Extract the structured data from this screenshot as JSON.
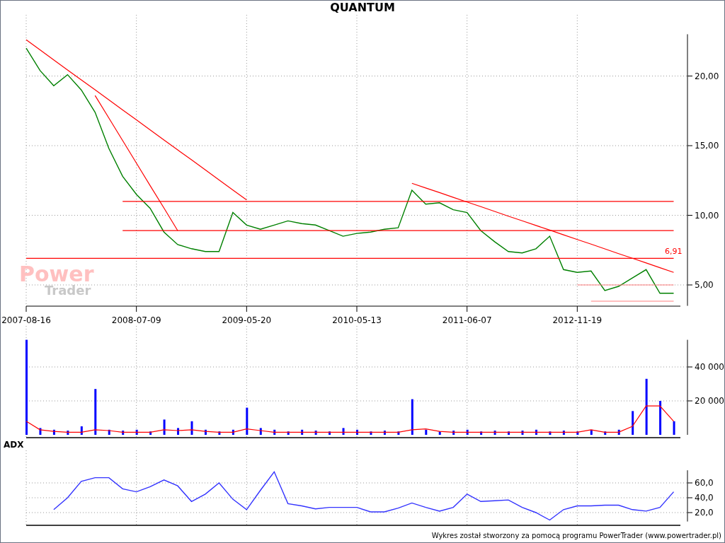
{
  "title": "QUANTUM",
  "logo": {
    "line1": "Power",
    "line2": "Trader"
  },
  "price_panel": {
    "chart_data": {
      "type": "line",
      "ylim": [
        3.5,
        23
      ],
      "categories": [
        "2007-08-16",
        null,
        null,
        null,
        null,
        null,
        null,
        null,
        "2008-07-09",
        null,
        null,
        null,
        null,
        null,
        null,
        null,
        "2009-05-20",
        null,
        null,
        null,
        null,
        null,
        null,
        null,
        "2010-05-13",
        null,
        null,
        null,
        null,
        null,
        null,
        null,
        "2011-06-07",
        null,
        null,
        null,
        null,
        null,
        null,
        null,
        "2012-11-19",
        null,
        null,
        null,
        null,
        null,
        null,
        null
      ],
      "yticks": [
        {
          "value": 5,
          "label": "5,00"
        },
        {
          "value": 10,
          "label": "10,00"
        },
        {
          "value": 15,
          "label": "15,00"
        },
        {
          "value": 20,
          "label": "20,00"
        }
      ],
      "grid": true,
      "series": [
        {
          "color": "#008000",
          "values": [
            22.0,
            20.4,
            19.3,
            20.1,
            19.0,
            17.4,
            14.8,
            12.8,
            11.5,
            10.5,
            8.8,
            7.9,
            7.6,
            7.4,
            7.4,
            10.2,
            9.3,
            9.0,
            9.3,
            9.6,
            9.4,
            9.3,
            8.9,
            8.5,
            8.7,
            8.8,
            9.0,
            9.1,
            11.8,
            10.8,
            10.9,
            10.4,
            10.2,
            8.9,
            8.1,
            7.4,
            7.3,
            7.6,
            8.5,
            6.1,
            5.9,
            6.0,
            4.6,
            4.9,
            5.5,
            6.1,
            4.4,
            4.4
          ]
        },
        {
          "color": "#ff0000",
          "values": [
            22.6,
            21.88,
            21.16,
            20.44,
            19.73,
            19.01,
            18.29,
            17.57,
            16.85,
            16.13,
            15.41,
            14.69,
            13.98,
            13.26,
            12.54,
            11.82,
            11.1,
            null,
            null,
            null,
            null,
            null,
            null,
            null,
            null,
            null,
            null,
            null,
            null,
            null,
            null,
            null,
            null,
            null,
            null,
            null,
            null,
            null,
            null,
            null,
            null,
            null,
            null,
            null,
            null,
            null,
            null,
            null
          ]
        },
        {
          "color": "#ff0000",
          "values": [
            null,
            null,
            null,
            null,
            null,
            18.6,
            16.98,
            15.37,
            13.75,
            12.13,
            10.52,
            8.9,
            null,
            null,
            null,
            null,
            null,
            null,
            null,
            null,
            null,
            null,
            null,
            null,
            null,
            null,
            null,
            null,
            null,
            null,
            null,
            null,
            null,
            null,
            null,
            null,
            null,
            null,
            null,
            null,
            null,
            null,
            null,
            null,
            null,
            null,
            null,
            null
          ]
        },
        {
          "color": "#ff0000",
          "values": [
            null,
            null,
            null,
            null,
            null,
            null,
            null,
            null,
            null,
            null,
            null,
            null,
            null,
            null,
            null,
            null,
            null,
            null,
            null,
            null,
            null,
            null,
            null,
            null,
            null,
            null,
            null,
            null,
            12.3,
            11.96,
            11.63,
            11.29,
            10.95,
            10.62,
            10.28,
            9.94,
            9.61,
            9.27,
            8.94,
            8.6,
            8.26,
            7.93,
            7.59,
            7.25,
            6.92,
            6.58,
            6.24,
            5.9
          ]
        },
        {
          "color": "#ff0000",
          "values": [
            null,
            null,
            null,
            null,
            null,
            null,
            null,
            11.0,
            11.0,
            11.0,
            11.0,
            11.0,
            11.0,
            11.0,
            11.0,
            11.0,
            11.0,
            11.0,
            11.0,
            11.0,
            11.0,
            11.0,
            11.0,
            11.0,
            11.0,
            11.0,
            11.0,
            11.0,
            11.0,
            11.0,
            11.0,
            11.0,
            11.0,
            11.0,
            11.0,
            11.0,
            11.0,
            11.0,
            11.0,
            11.0,
            11.0,
            11.0,
            11.0,
            11.0,
            11.0,
            11.0,
            11.0,
            11.0
          ]
        },
        {
          "color": "#ff0000",
          "values": [
            null,
            null,
            null,
            null,
            null,
            null,
            null,
            8.9,
            8.9,
            8.9,
            8.9,
            8.9,
            8.9,
            8.9,
            8.9,
            8.9,
            8.9,
            8.9,
            8.9,
            8.9,
            8.9,
            8.9,
            8.9,
            8.9,
            8.9,
            8.9,
            8.9,
            8.9,
            8.9,
            8.9,
            8.9,
            8.9,
            8.9,
            8.9,
            8.9,
            8.9,
            8.9,
            8.9,
            8.9,
            8.9,
            8.9,
            8.9,
            8.9,
            8.9,
            8.9,
            8.9,
            8.9,
            8.9
          ]
        },
        {
          "color": "#ff8080",
          "values": [
            null,
            null,
            null,
            null,
            null,
            null,
            null,
            null,
            null,
            null,
            null,
            null,
            null,
            null,
            null,
            null,
            null,
            null,
            null,
            null,
            null,
            null,
            null,
            null,
            null,
            null,
            null,
            null,
            null,
            null,
            null,
            null,
            null,
            null,
            null,
            null,
            null,
            null,
            null,
            null,
            5.0,
            5.0,
            5.0,
            5.0,
            5.0,
            5.0,
            5.0,
            5.0
          ]
        },
        {
          "color": "#ff8080",
          "values": [
            null,
            null,
            null,
            null,
            null,
            null,
            null,
            null,
            null,
            null,
            null,
            null,
            null,
            null,
            null,
            null,
            null,
            null,
            null,
            null,
            null,
            null,
            null,
            null,
            null,
            null,
            null,
            null,
            null,
            null,
            null,
            null,
            null,
            null,
            null,
            null,
            null,
            null,
            null,
            null,
            null,
            3.83,
            3.83,
            3.83,
            3.83,
            3.83,
            3.83,
            3.83
          ]
        },
        {
          "color": "#ff0000",
          "values": [
            6.91,
            6.91,
            6.91,
            6.91,
            6.91,
            6.91,
            6.91,
            6.91,
            6.91,
            6.91,
            6.91,
            6.91,
            6.91,
            6.91,
            6.91,
            6.91,
            6.91,
            6.91,
            6.91,
            6.91,
            6.91,
            6.91,
            6.91,
            6.91,
            6.91,
            6.91,
            6.91,
            6.91,
            6.91,
            6.91,
            6.91,
            6.91,
            6.91,
            6.91,
            6.91,
            6.91,
            6.91,
            6.91,
            6.91,
            6.91,
            6.91,
            6.91,
            6.91,
            6.91,
            6.91,
            6.91,
            6.91,
            6.91
          ]
        }
      ]
    },
    "level_label": "6,91"
  },
  "volume_panel": {
    "chart_data": {
      "type": "bar",
      "ylim": [
        0,
        56000
      ],
      "grid": true,
      "categories": [
        null,
        null,
        null,
        null,
        null,
        null,
        null,
        null,
        null,
        null,
        null,
        null,
        null,
        null,
        null,
        null,
        null,
        null,
        null,
        null,
        null,
        null,
        null,
        null,
        null,
        null,
        null,
        null,
        null,
        null,
        null,
        null,
        null,
        null,
        null,
        null,
        null,
        null,
        null,
        null,
        null,
        null,
        null,
        null,
        null,
        null,
        null,
        null
      ],
      "yticks": [
        {
          "value": 20000,
          "label": "20 000"
        },
        {
          "value": 40000,
          "label": "40 000"
        }
      ],
      "series": [
        {
          "color": "#0000ff",
          "values": [
            56000,
            4000,
            3000,
            2500,
            5000,
            27000,
            3000,
            2500,
            3000,
            2000,
            9000,
            4000,
            8000,
            3000,
            2000,
            3000,
            16000,
            4000,
            3000,
            2000,
            3000,
            2500,
            2000,
            4000,
            3000,
            2000,
            2500,
            2000,
            21000,
            3000,
            2000,
            2500,
            3000,
            2000,
            2500,
            2000,
            2500,
            3000,
            2000,
            2500,
            2000,
            3000,
            2000,
            3000,
            14000,
            33000,
            20000,
            8000
          ]
        },
        {
          "type": "line",
          "color": "#ff0000",
          "values": [
            8000,
            3000,
            2000,
            1500,
            1500,
            3000,
            2500,
            1500,
            1500,
            1500,
            3000,
            2500,
            3000,
            2000,
            1500,
            1500,
            3500,
            2500,
            1500,
            1500,
            1500,
            1500,
            1500,
            1500,
            1500,
            1500,
            1500,
            1500,
            3000,
            3500,
            2000,
            1500,
            1500,
            1500,
            1500,
            1500,
            1500,
            1500,
            1500,
            1500,
            1500,
            3000,
            1500,
            1500,
            5000,
            17000,
            17000,
            8000
          ]
        }
      ]
    }
  },
  "adx_panel": {
    "label": "ADX",
    "chart_data": {
      "type": "line",
      "ylim": [
        8,
        77
      ],
      "grid": true,
      "categories": [
        null,
        null,
        null,
        null,
        null,
        null,
        null,
        null,
        null,
        null,
        null,
        null,
        null,
        null,
        null,
        null,
        null,
        null,
        null,
        null,
        null,
        null,
        null,
        null,
        null,
        null,
        null,
        null,
        null,
        null,
        null,
        null,
        null,
        null,
        null,
        null,
        null,
        null,
        null,
        null,
        null,
        null,
        null,
        null,
        null,
        null,
        null,
        null
      ],
      "yticks": [
        {
          "value": 20,
          "label": "20,0"
        },
        {
          "value": 40,
          "label": "40,0"
        },
        {
          "value": 60,
          "label": "60,0"
        }
      ],
      "series": [
        {
          "color": "#3333ff",
          "values": [
            null,
            null,
            24,
            40,
            62,
            67,
            67,
            52,
            48,
            55,
            64,
            56,
            35,
            45,
            60,
            38,
            24,
            50,
            75,
            32,
            29,
            25,
            27,
            27,
            27,
            21,
            21,
            26,
            33,
            27,
            22,
            27,
            45,
            35,
            36,
            37,
            27,
            20,
            10,
            24,
            29,
            29,
            30,
            30,
            24,
            22,
            27,
            48
          ]
        }
      ]
    }
  },
  "footer": "Wykres został stworzony za pomocą programu PowerTrader (www.powertrader.pl)"
}
